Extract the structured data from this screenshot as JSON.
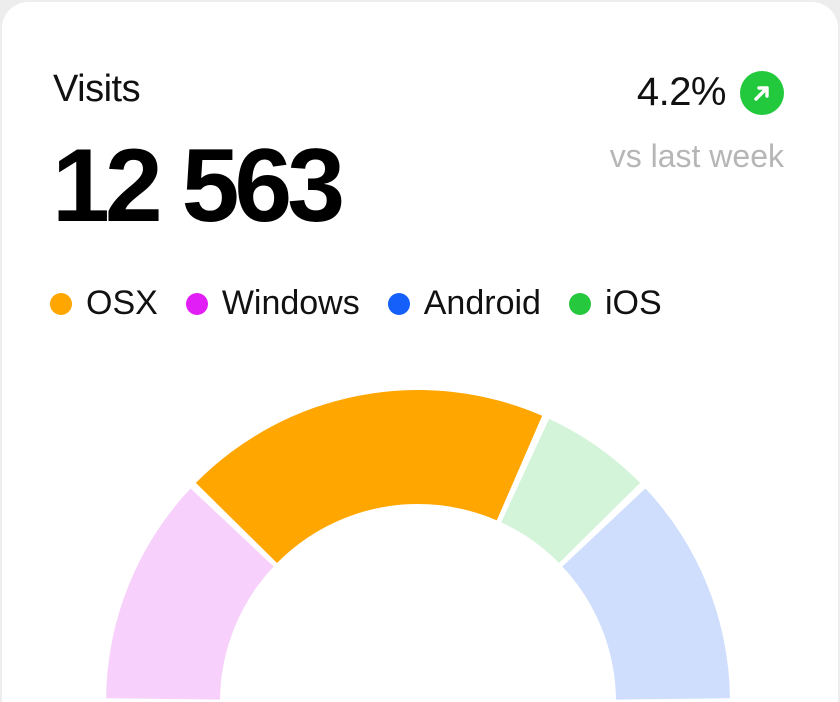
{
  "widget": {
    "title": "Visits",
    "total": "12 563",
    "change": "4.2%",
    "change_icon": "arrow-up-right-icon",
    "change_color": "#22c93d",
    "compare_label": "vs last week"
  },
  "chart_data": {
    "type": "pie",
    "variant": "half-donut",
    "categories": [
      "OSX",
      "Windows",
      "Android",
      "iOS"
    ],
    "legend_position": "top-left",
    "series": [
      {
        "name": "OSX",
        "value": 32,
        "color": "#ffa600",
        "fill": "#ffa600"
      },
      {
        "name": "Windows",
        "value": 20,
        "color": "#e01ef5",
        "fill": "#f7d1fb"
      },
      {
        "name": "Android",
        "value": 20,
        "color": "#1560fa",
        "fill": "#cfdefc"
      },
      {
        "name": "iOS",
        "value": 10,
        "color": "#26c93d",
        "fill": "#d4f4d9"
      }
    ],
    "segment_order": [
      "Windows",
      "OSX",
      "iOS",
      "Android"
    ]
  }
}
